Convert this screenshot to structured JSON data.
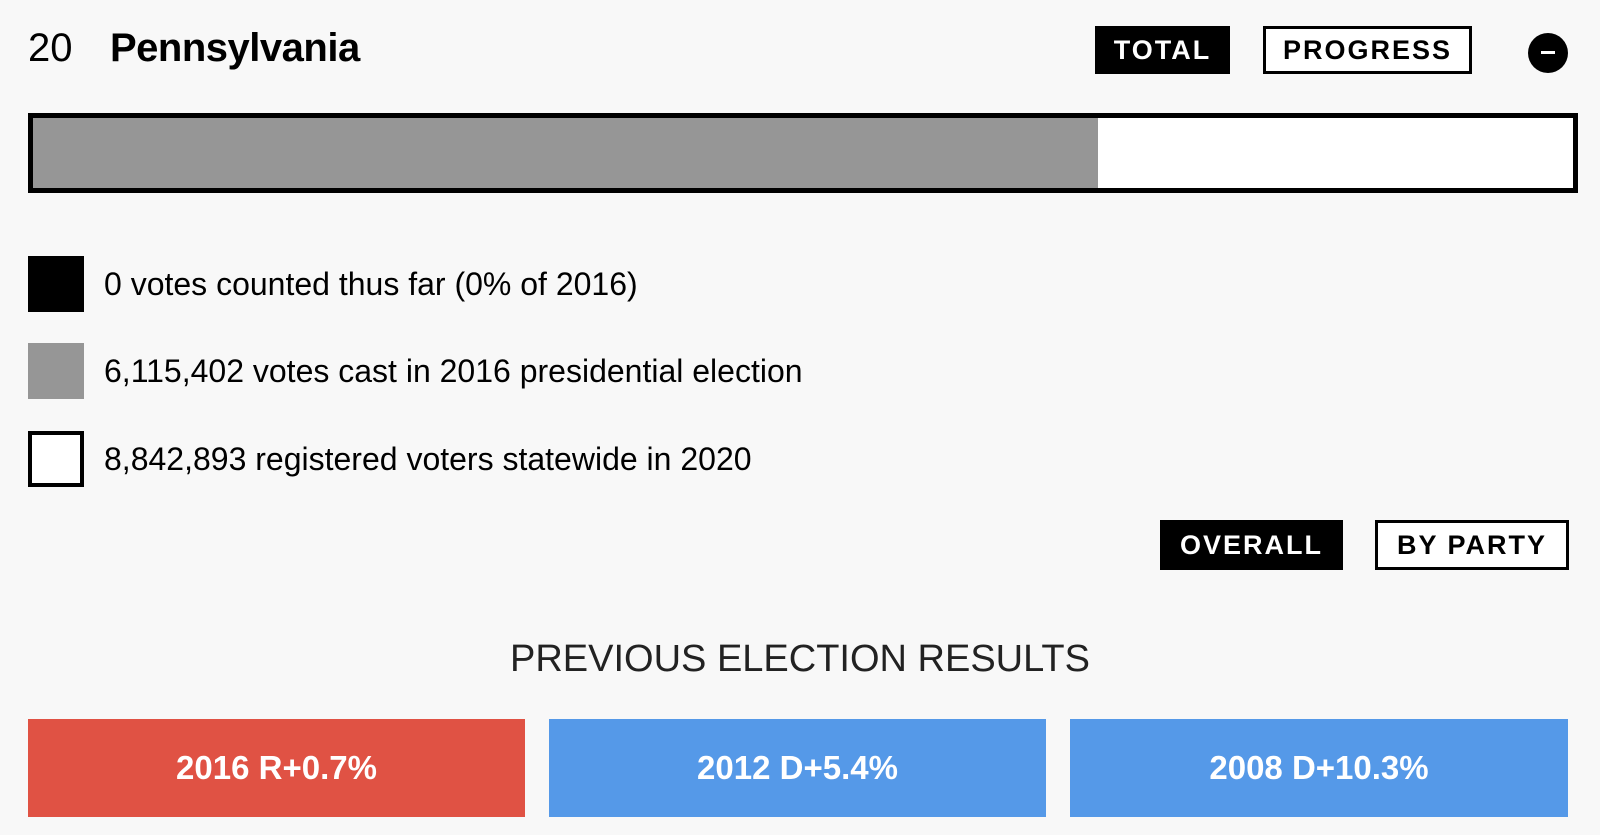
{
  "header": {
    "electoral_votes": "20",
    "state": "Pennsylvania",
    "toggle_total": "TOTAL",
    "toggle_progress": "PROGRESS",
    "collapse_icon": "minus-circle-icon"
  },
  "progress": {
    "counted_fraction": 0.0,
    "votes_2016_fraction_of_registered": 0.6916
  },
  "legend": {
    "counted": "0 votes counted thus far (0% of 2016)",
    "cast_2016": "6,115,402 votes cast in 2016 presidential election",
    "registered": "8,842,893 registered voters statewide in 2020"
  },
  "view_toggle": {
    "overall": "OVERALL",
    "by_party": "BY PARTY"
  },
  "previous": {
    "title": "PREVIOUS ELECTION RESULTS",
    "results": [
      {
        "label": "2016 R+0.7%",
        "party": "R"
      },
      {
        "label": "2012 D+5.4%",
        "party": "D"
      },
      {
        "label": "2008 D+10.3%",
        "party": "D"
      }
    ]
  },
  "colors": {
    "republican": "#e05244",
    "democrat": "#5599e8",
    "votes_2016": "#969696",
    "counted": "#000000",
    "background": "#f8f8f8"
  }
}
